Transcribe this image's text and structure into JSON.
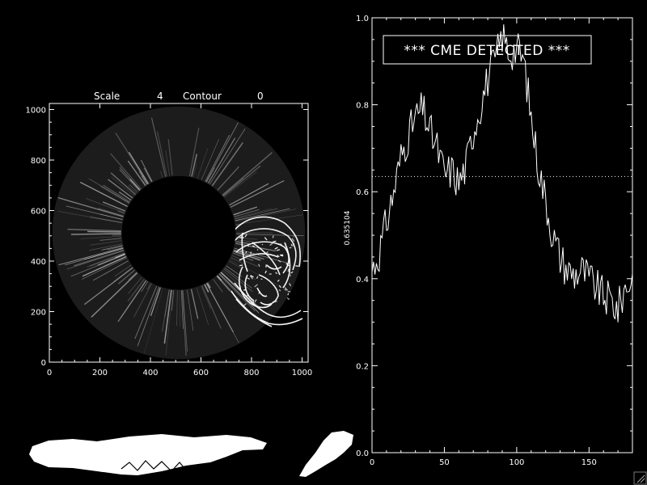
{
  "header": {
    "scale_label": "Scale",
    "scale_value": "4",
    "contour_label": "Contour",
    "contour_value": "0"
  },
  "banner": {
    "text": "*** CME DETECTED ***"
  },
  "colors": {
    "background": "#000000",
    "foreground": "#ffffff"
  },
  "chart_data": [
    {
      "type": "image",
      "xlim": [
        0,
        1024
      ],
      "ylim": [
        0,
        1024
      ],
      "xticks": [
        "0",
        "200",
        "400",
        "600",
        "800",
        "1000"
      ],
      "yticks": [
        "0",
        "200",
        "400",
        "600",
        "800",
        "1000"
      ],
      "occulter_center": [
        512,
        512
      ],
      "occulter_radius": 225,
      "field_radius": 500
    },
    {
      "type": "line",
      "xlim": [
        0,
        180
      ],
      "ylim": [
        0,
        1.0
      ],
      "xticks": [
        "0",
        "50",
        "100",
        "150"
      ],
      "yticks": [
        "0.0",
        "0.2",
        "0.4",
        "0.6",
        "0.8",
        "1.0"
      ],
      "ylabel": "0.635104",
      "threshold": 0.635104,
      "series_anchor_x": [
        0,
        5,
        10,
        15,
        20,
        25,
        30,
        35,
        40,
        45,
        50,
        55,
        60,
        65,
        70,
        75,
        80,
        85,
        90,
        95,
        100,
        105,
        110,
        115,
        120,
        125,
        130,
        135,
        140,
        145,
        150,
        155,
        160,
        165,
        170,
        175,
        180
      ],
      "series_anchor_y": [
        0.42,
        0.46,
        0.53,
        0.6,
        0.68,
        0.73,
        0.77,
        0.79,
        0.74,
        0.7,
        0.64,
        0.65,
        0.62,
        0.66,
        0.74,
        0.8,
        0.86,
        0.9,
        0.96,
        0.92,
        0.93,
        0.9,
        0.77,
        0.66,
        0.58,
        0.5,
        0.45,
        0.42,
        0.41,
        0.42,
        0.4,
        0.38,
        0.36,
        0.35,
        0.33,
        0.38,
        0.4
      ]
    }
  ]
}
